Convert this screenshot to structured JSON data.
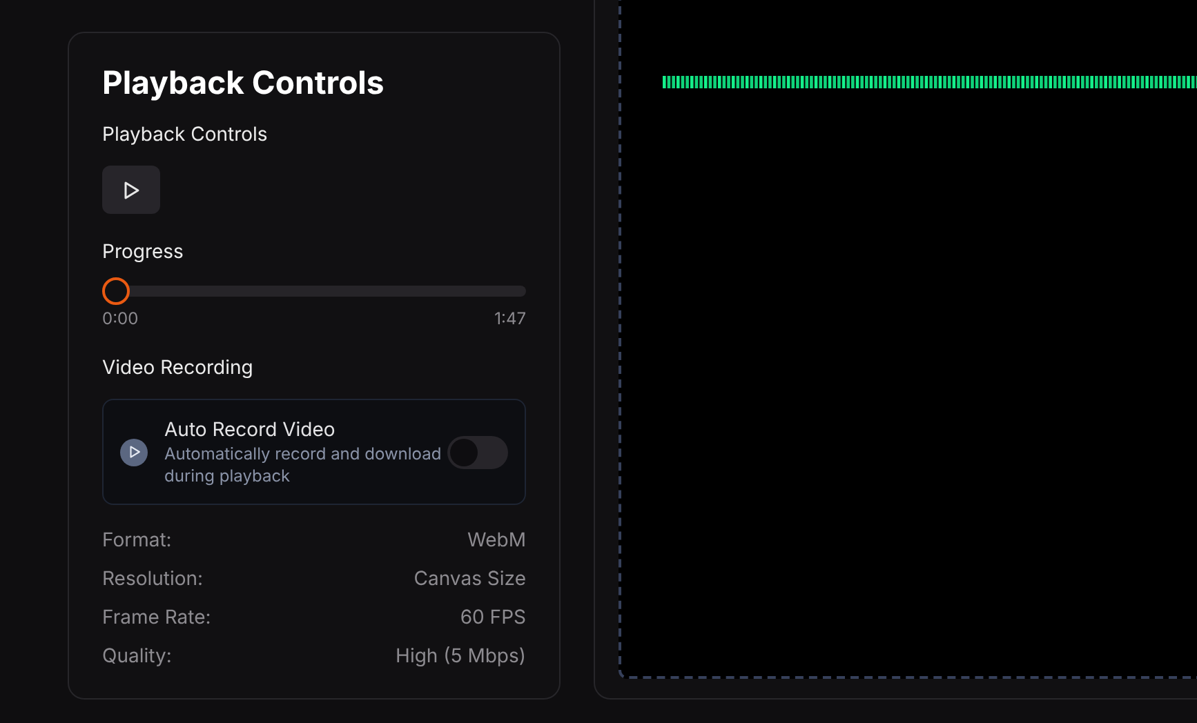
{
  "panel": {
    "title": "Playback Controls"
  },
  "playback": {
    "heading": "Playback Controls",
    "playing": false
  },
  "progress": {
    "heading": "Progress",
    "level": 0,
    "current": "0:00",
    "total": "1:47"
  },
  "recording": {
    "heading": "Video Recording",
    "option": {
      "title": "Auto Record Video",
      "description": "Automatically record and download during playback",
      "on": false
    },
    "details": [
      {
        "label": "Format:",
        "value": "WebM"
      },
      {
        "label": "Resolution:",
        "value": "Canvas Size"
      },
      {
        "label": "Frame Rate:",
        "value": "60 FPS"
      },
      {
        "label": "Quality:",
        "value": "High (5 Mbps)"
      }
    ]
  }
}
